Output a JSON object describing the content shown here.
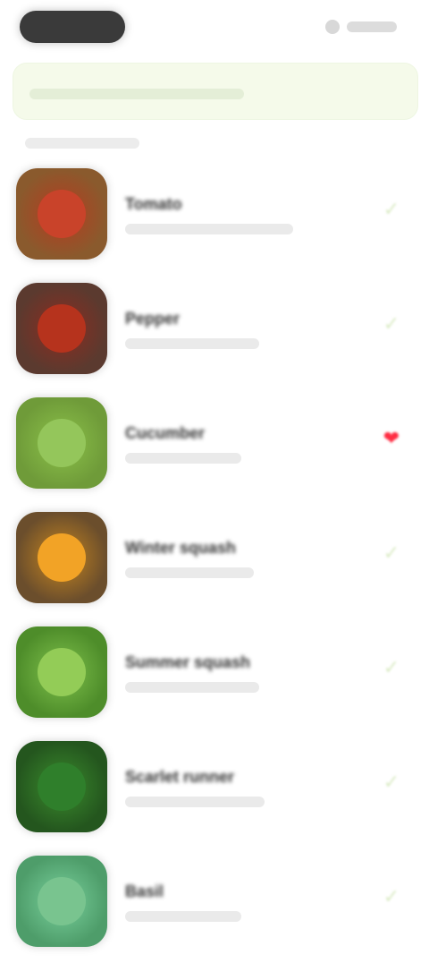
{
  "header": {
    "pill": "",
    "action_icon": "profile-icon",
    "action_label": ""
  },
  "banner": {
    "text": ""
  },
  "section": {
    "label": ""
  },
  "items": [
    {
      "title": "Tomato",
      "subtitle": "",
      "status": "check-icon",
      "colors": {
        "a": "#8a5a2d",
        "b": "#b63b1f",
        "center": "#c9432a"
      }
    },
    {
      "title": "Pepper",
      "subtitle": "",
      "status": "check-icon",
      "colors": {
        "a": "#5b3a2f",
        "b": "#8f2b1f",
        "center": "#b6331d"
      }
    },
    {
      "title": "Cucumber",
      "subtitle": "",
      "status": "heart-icon",
      "colors": {
        "a": "#6f9b39",
        "b": "#8cc24a",
        "center": "#94c65b"
      }
    },
    {
      "title": "Winter squash",
      "subtitle": "",
      "status": "check-icon",
      "colors": {
        "a": "#6b4e2c",
        "b": "#c7861f",
        "center": "#f2a326"
      }
    },
    {
      "title": "Summer squash",
      "subtitle": "",
      "status": "check-icon",
      "colors": {
        "a": "#4e8d2a",
        "b": "#7fc14c",
        "center": "#93cc57"
      }
    },
    {
      "title": "Scarlet runner",
      "subtitle": "",
      "status": "check-icon",
      "colors": {
        "a": "#24561e",
        "b": "#3b8c2d",
        "center": "#2f7f2b"
      }
    },
    {
      "title": "Basil",
      "subtitle": "",
      "status": "check-icon",
      "colors": {
        "a": "#4e9d6a",
        "b": "#7ad19d",
        "center": "#79c48f"
      }
    }
  ]
}
